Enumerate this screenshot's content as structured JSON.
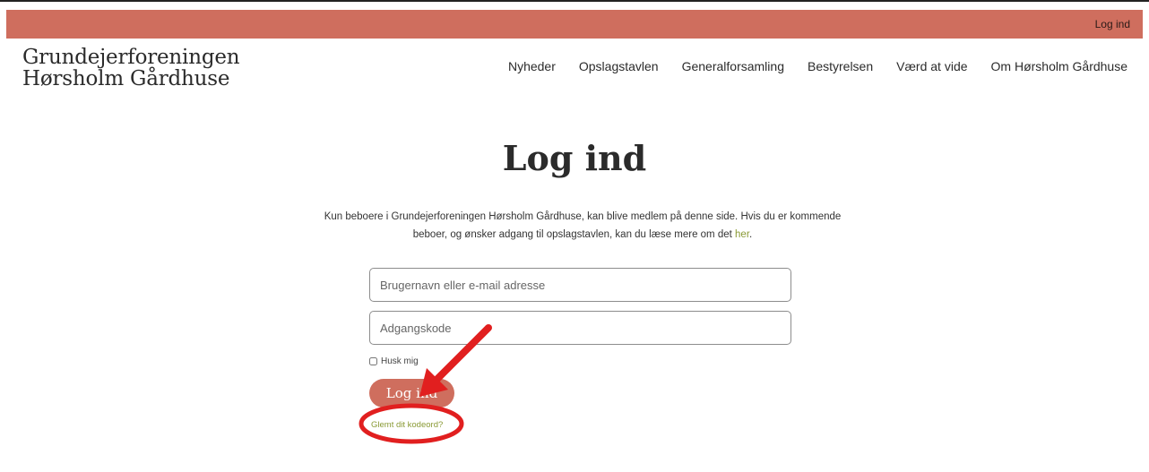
{
  "colors": {
    "accent": "#cf6e5e",
    "link": "#8a9a35",
    "annotation": "#e11f1f"
  },
  "topbar": {
    "login_link": "Log ind"
  },
  "logo": {
    "line1": "Grundejerforeningen",
    "line2": "Hørsholm Gårdhuse"
  },
  "nav": {
    "items": [
      "Nyheder",
      "Opslagstavlen",
      "Generalforsamling",
      "Bestyrelsen",
      "Værd at vide",
      "Om Hørsholm Gårdhuse"
    ]
  },
  "main": {
    "title": "Log ind",
    "intro_line1": "Kun beboere i Grundejerforeningen Hørsholm Gårdhuse, kan blive medlem på denne side. Hvis du er kommende",
    "intro_line2_prefix": "beboer, og ønsker adgang til opslagstavlen, kan du læse mere om det ",
    "intro_link": "her",
    "intro_suffix": "."
  },
  "form": {
    "username_placeholder": "Brugernavn eller e-mail adresse",
    "username_value": "",
    "password_placeholder": "Adgangskode",
    "password_value": "",
    "remember_label": "Husk mig",
    "remember_checked": false,
    "submit_label": "Log ind",
    "forgot_label": "Glemt dit kodeord?"
  },
  "annotations": {
    "arrow": "red-arrow-icon",
    "circle": "red-circle-highlight"
  }
}
